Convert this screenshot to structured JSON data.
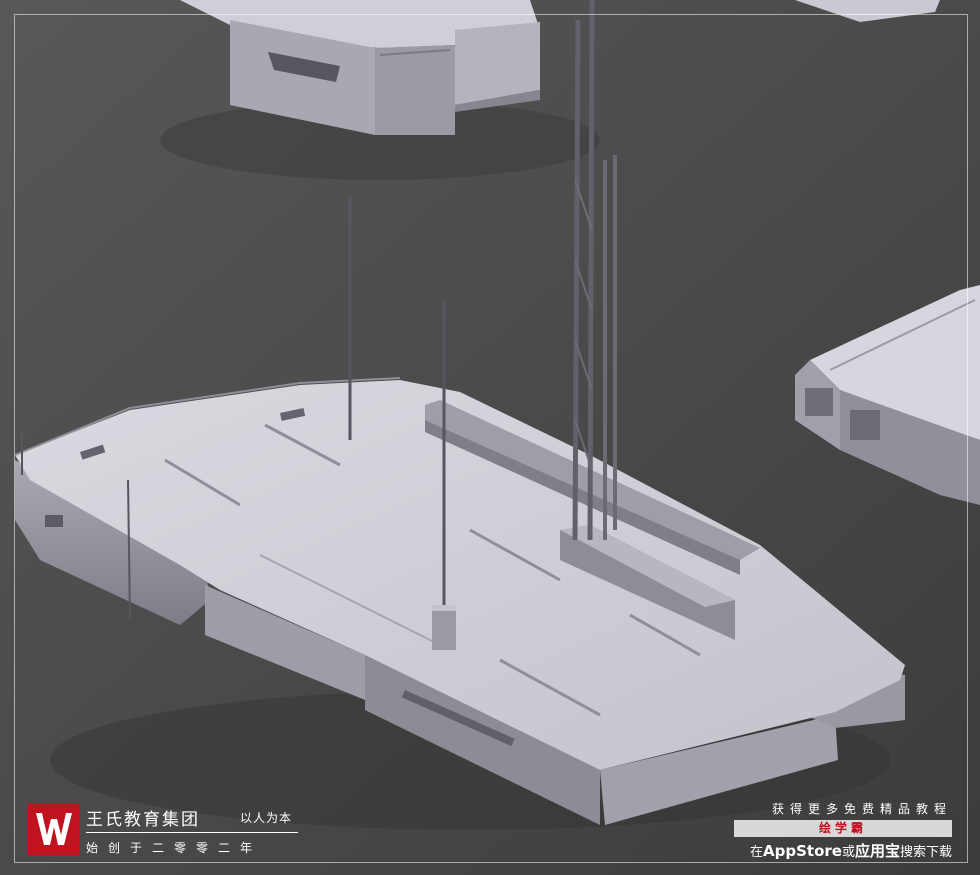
{
  "brand": {
    "name": "王氏教育集团",
    "motto": "以人为本",
    "founded": "始创于二零零二年",
    "logo_letter": "W",
    "logo_color": "#c1121f"
  },
  "promo": {
    "line1": "获得更多免费精品教程",
    "app_name": "绘学霸",
    "line3_prefix": "在",
    "line3_store1": "AppStore",
    "line3_or": "或",
    "line3_store2": "应用宝",
    "line3_suffix": "搜索下载"
  },
  "scene": {
    "subject": "sci-fi floating platform render",
    "background_color": "#4b4b4b",
    "hull_color": "#c9c9d1"
  }
}
